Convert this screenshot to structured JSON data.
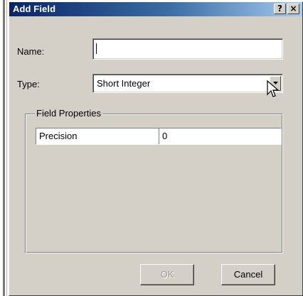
{
  "dialog": {
    "title": "Add Field",
    "help_label": "?",
    "close_label": "×"
  },
  "form": {
    "name_label": "Name:",
    "name_value": "",
    "type_label": "Type:",
    "type_value": "Short Integer"
  },
  "field_properties": {
    "legend": "Field Properties",
    "rows": [
      {
        "property": "Precision",
        "value": "0"
      }
    ]
  },
  "buttons": {
    "ok_label": "OK",
    "cancel_label": "Cancel"
  },
  "colors": {
    "title_start": "#0a246a",
    "title_end": "#a6caf0",
    "face": "#d4d0c8"
  }
}
